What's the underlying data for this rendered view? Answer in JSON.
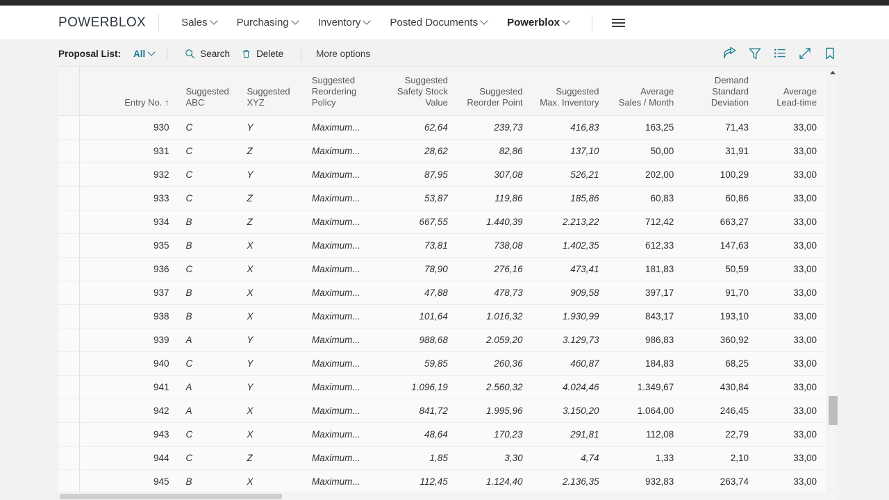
{
  "nav": {
    "brand": "POWERBLOX",
    "items": [
      {
        "label": "Sales",
        "active": false
      },
      {
        "label": "Purchasing",
        "active": false
      },
      {
        "label": "Inventory",
        "active": false
      },
      {
        "label": "Posted Documents",
        "active": false
      },
      {
        "label": "Powerblox",
        "active": true
      }
    ],
    "menu_icon": "hamburger-icon"
  },
  "toolbar": {
    "list_label": "Proposal List:",
    "filter_value": "All",
    "search_label": "Search",
    "delete_label": "Delete",
    "more_options_label": "More options",
    "right_icons": [
      "share-icon",
      "filter-icon",
      "list-icon",
      "expand-icon",
      "bookmark-icon"
    ]
  },
  "table": {
    "columns": [
      {
        "key": "sel",
        "label": "",
        "align": "left"
      },
      {
        "key": "entry",
        "label": "Entry No. ↑",
        "align": "right"
      },
      {
        "key": "abc",
        "label": "Suggested ABC",
        "align": "left"
      },
      {
        "key": "xyz",
        "label": "Suggested XYZ",
        "align": "left"
      },
      {
        "key": "policy",
        "label": "Suggested Reordering Policy",
        "align": "left"
      },
      {
        "key": "safety",
        "label": "Suggested Safety Stock Value",
        "align": "right"
      },
      {
        "key": "reorder",
        "label": "Suggested Reorder Point",
        "align": "right"
      },
      {
        "key": "maxinv",
        "label": "Suggested Max. Inventory",
        "align": "right"
      },
      {
        "key": "avgsales",
        "label": "Average Sales / Month",
        "align": "right"
      },
      {
        "key": "dsd",
        "label": "Demand Standard Deviation",
        "align": "right"
      },
      {
        "key": "lead",
        "label": "Average Lead-time",
        "align": "right"
      }
    ],
    "rows": [
      {
        "entry": "930",
        "abc": "C",
        "xyz": "Y",
        "policy": "Maximum...",
        "safety": "62,64",
        "reorder": "239,73",
        "maxinv": "416,83",
        "avgsales": "163,25",
        "dsd": "71,43",
        "lead": "33,00"
      },
      {
        "entry": "931",
        "abc": "C",
        "xyz": "Z",
        "policy": "Maximum...",
        "safety": "28,62",
        "reorder": "82,86",
        "maxinv": "137,10",
        "avgsales": "50,00",
        "dsd": "31,91",
        "lead": "33,00"
      },
      {
        "entry": "932",
        "abc": "C",
        "xyz": "Y",
        "policy": "Maximum...",
        "safety": "87,95",
        "reorder": "307,08",
        "maxinv": "526,21",
        "avgsales": "202,00",
        "dsd": "100,29",
        "lead": "33,00"
      },
      {
        "entry": "933",
        "abc": "C",
        "xyz": "Z",
        "policy": "Maximum...",
        "safety": "53,87",
        "reorder": "119,86",
        "maxinv": "185,86",
        "avgsales": "60,83",
        "dsd": "60,86",
        "lead": "33,00"
      },
      {
        "entry": "934",
        "abc": "B",
        "xyz": "Z",
        "policy": "Maximum...",
        "safety": "667,55",
        "reorder": "1.440,39",
        "maxinv": "2.213,22",
        "avgsales": "712,42",
        "dsd": "663,27",
        "lead": "33,00"
      },
      {
        "entry": "935",
        "abc": "B",
        "xyz": "X",
        "policy": "Maximum...",
        "safety": "73,81",
        "reorder": "738,08",
        "maxinv": "1.402,35",
        "avgsales": "612,33",
        "dsd": "147,63",
        "lead": "33,00"
      },
      {
        "entry": "936",
        "abc": "C",
        "xyz": "X",
        "policy": "Maximum...",
        "safety": "78,90",
        "reorder": "276,16",
        "maxinv": "473,41",
        "avgsales": "181,83",
        "dsd": "50,59",
        "lead": "33,00"
      },
      {
        "entry": "937",
        "abc": "B",
        "xyz": "X",
        "policy": "Maximum...",
        "safety": "47,88",
        "reorder": "478,73",
        "maxinv": "909,58",
        "avgsales": "397,17",
        "dsd": "91,70",
        "lead": "33,00"
      },
      {
        "entry": "938",
        "abc": "B",
        "xyz": "X",
        "policy": "Maximum...",
        "safety": "101,64",
        "reorder": "1.016,32",
        "maxinv": "1.930,99",
        "avgsales": "843,17",
        "dsd": "193,10",
        "lead": "33,00"
      },
      {
        "entry": "939",
        "abc": "A",
        "xyz": "Y",
        "policy": "Maximum...",
        "safety": "988,68",
        "reorder": "2.059,20",
        "maxinv": "3.129,73",
        "avgsales": "986,83",
        "dsd": "360,92",
        "lead": "33,00"
      },
      {
        "entry": "940",
        "abc": "C",
        "xyz": "Y",
        "policy": "Maximum...",
        "safety": "59,85",
        "reorder": "260,36",
        "maxinv": "460,87",
        "avgsales": "184,83",
        "dsd": "68,25",
        "lead": "33,00"
      },
      {
        "entry": "941",
        "abc": "A",
        "xyz": "Y",
        "policy": "Maximum...",
        "safety": "1.096,19",
        "reorder": "2.560,32",
        "maxinv": "4.024,46",
        "avgsales": "1.349,67",
        "dsd": "430,84",
        "lead": "33,00"
      },
      {
        "entry": "942",
        "abc": "A",
        "xyz": "X",
        "policy": "Maximum...",
        "safety": "841,72",
        "reorder": "1.995,96",
        "maxinv": "3.150,20",
        "avgsales": "1.064,00",
        "dsd": "246,45",
        "lead": "33,00"
      },
      {
        "entry": "943",
        "abc": "C",
        "xyz": "X",
        "policy": "Maximum...",
        "safety": "48,64",
        "reorder": "170,23",
        "maxinv": "291,81",
        "avgsales": "112,08",
        "dsd": "22,79",
        "lead": "33,00"
      },
      {
        "entry": "944",
        "abc": "C",
        "xyz": "Z",
        "policy": "Maximum...",
        "safety": "1,85",
        "reorder": "3,30",
        "maxinv": "4,74",
        "avgsales": "1,33",
        "dsd": "2,10",
        "lead": "33,00"
      },
      {
        "entry": "945",
        "abc": "B",
        "xyz": "X",
        "policy": "Maximum...",
        "safety": "112,45",
        "reorder": "1.124,40",
        "maxinv": "2.136,35",
        "avgsales": "932,83",
        "dsd": "263,74",
        "lead": "33,00"
      }
    ]
  },
  "colors": {
    "accent": "#18798a",
    "link": "#1a7f8e",
    "page_bg": "#f2f2f2",
    "grid_bg": "#fafafa",
    "header_bg": "#f5f5f5",
    "top_strip": "#2b2b2b"
  }
}
